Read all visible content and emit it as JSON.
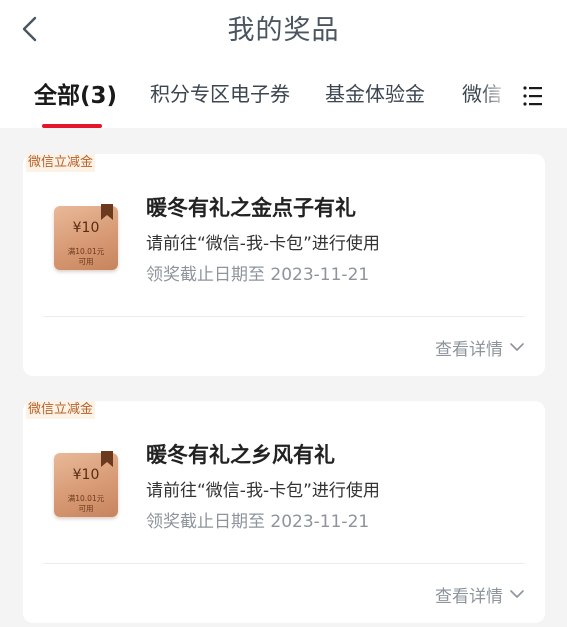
{
  "header": {
    "title": "我的奖品"
  },
  "tabs": [
    {
      "label": "全部(3)",
      "active": true
    },
    {
      "label": "积分专区电子券",
      "active": false
    },
    {
      "label": "基金体验金",
      "active": false
    },
    {
      "label": "微信",
      "active": false
    }
  ],
  "colors": {
    "accent": "#e4162b",
    "tag_text": "#b5622a",
    "muted_text": "#8d949c"
  },
  "prizes": [
    {
      "tag": "微信立减金",
      "coupon_amount": "¥10",
      "coupon_condition_line1": "满10.01元",
      "coupon_condition_line2": "可用",
      "title": "暖冬有礼之金点子有礼",
      "description": "请前往“微信-我-卡包”进行使用",
      "deadline": "领奖截止日期至 2023-11-21",
      "details_label": "查看详情"
    },
    {
      "tag": "微信立减金",
      "coupon_amount": "¥10",
      "coupon_condition_line1": "满10.01元",
      "coupon_condition_line2": "可用",
      "title": "暖冬有礼之乡风有礼",
      "description": "请前往“微信-我-卡包”进行使用",
      "deadline": "领奖截止日期至 2023-11-21",
      "details_label": "查看详情"
    }
  ]
}
